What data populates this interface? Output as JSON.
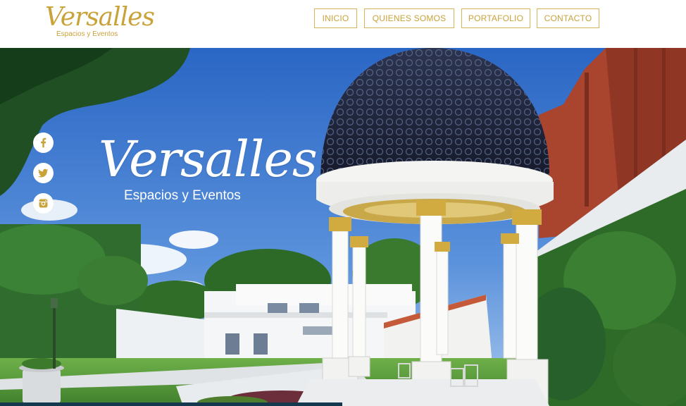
{
  "brand": {
    "name": "Versalles",
    "tagline": "Espacios y Eventos"
  },
  "nav": {
    "items": [
      {
        "label": "INICIO"
      },
      {
        "label": "QUIENES SOMOS"
      },
      {
        "label": "PORTAFOLIO"
      },
      {
        "label": "CONTACTO"
      }
    ]
  },
  "hero": {
    "title": "Versalles",
    "subtitle": "Espacios y Eventos"
  },
  "social": [
    {
      "icon": "facebook-icon"
    },
    {
      "icon": "twitter-icon"
    },
    {
      "icon": "instagram-icon"
    }
  ],
  "colors": {
    "gold": "#c9a23a",
    "sky": "#2f6fc6",
    "footer": "#14394f"
  }
}
